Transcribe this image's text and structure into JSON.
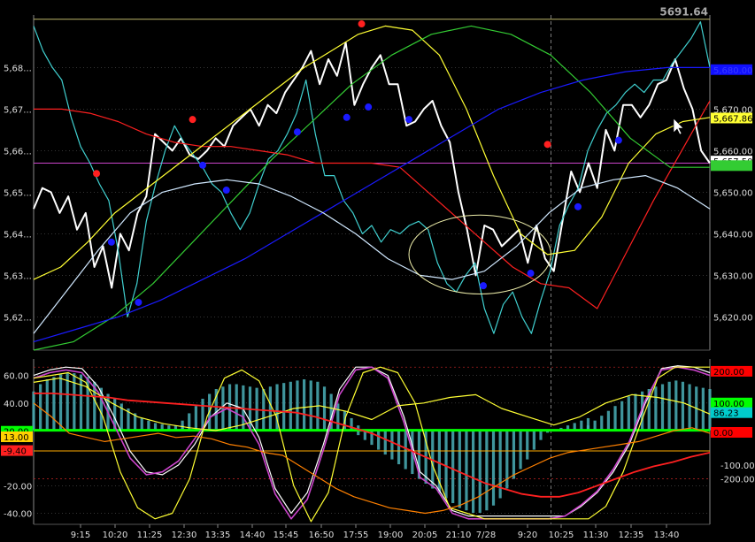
{
  "chart_data": [
    {
      "type": "line",
      "panel": "price",
      "grid": true,
      "ylim": [
        5612,
        5692
      ],
      "left_ticks": [
        "5,68...",
        "5,67...",
        "5,66...",
        "5,65...",
        "5,64...",
        "5,63...",
        "5,62..."
      ],
      "right_ticks": [
        "5,680.00",
        "5,670.00",
        "5,660.00",
        "5,650.00",
        "5,640.00",
        "5,630.00",
        "5,620.00"
      ],
      "left_tick_values": [
        5680,
        5670,
        5660,
        5650,
        5640,
        5630,
        5620
      ],
      "right_tick_values": [
        5680,
        5670,
        5660,
        5650,
        5640,
        5630,
        5620
      ],
      "top_value_label": "5691.64",
      "top_value": 5691.64,
      "value_labels": [
        {
          "text": "5,680.00",
          "value": 5679.5,
          "color": "#1010ff",
          "text_color": "#3a3aff"
        },
        {
          "text": "5,667.86",
          "value": 5667.86,
          "color": "#ffff33",
          "text_color": "#000000"
        },
        {
          "text": "5,657.50",
          "value": 5657.5,
          "color": "#ffffff",
          "text_color": "#000000"
        },
        {
          "text": "",
          "value": 5656.4,
          "color": "#33cc33",
          "text_color": "#000000"
        }
      ],
      "horizontal_lines": [
        {
          "value": 5691.64,
          "color": "#bdb76b"
        },
        {
          "value": 5657.0,
          "color": "#cc44cc"
        }
      ],
      "series": [
        {
          "color": "#ffffff",
          "width": 2,
          "values": [
            5646,
            5651,
            5650,
            5645,
            5649,
            5641,
            5645,
            5632,
            5637,
            5627,
            5640,
            5636,
            5645,
            5649,
            5664,
            5662,
            5660,
            5663,
            5659,
            5658,
            5660,
            5663,
            5661,
            5666,
            5668,
            5670,
            5666,
            5671,
            5669,
            5674,
            5677,
            5680,
            5684,
            5676,
            5682,
            5678,
            5686,
            5671,
            5676,
            5680,
            5683,
            5676,
            5676,
            5666,
            5667,
            5670,
            5672,
            5666,
            5662,
            5650,
            5641,
            5630,
            5642,
            5641,
            5637,
            5639,
            5641,
            5633,
            5642,
            5634,
            5631,
            5643,
            5655,
            5650,
            5657,
            5651,
            5665,
            5660,
            5671,
            5671,
            5668,
            5671,
            5676,
            5677,
            5682,
            5675,
            5670,
            5660,
            5657
          ]
        },
        {
          "color": "#40d0d0",
          "width": 1.2,
          "values": [
            5690,
            5684,
            5680,
            5677,
            5668,
            5661,
            5657,
            5652,
            5648,
            5636,
            5620,
            5628,
            5643,
            5652,
            5660,
            5666,
            5662,
            5659,
            5656,
            5652,
            5650,
            5645,
            5641,
            5645,
            5652,
            5658,
            5660,
            5664,
            5669,
            5677,
            5664,
            5654,
            5654,
            5648,
            5645,
            5640,
            5642,
            5638,
            5641,
            5640,
            5642,
            5643,
            5641,
            5633,
            5628,
            5626,
            5630,
            5633,
            5622,
            5616,
            5623,
            5626,
            5620,
            5616,
            5624,
            5631,
            5642,
            5647,
            5651,
            5660,
            5665,
            5669,
            5671,
            5674,
            5676,
            5674,
            5677,
            5677,
            5681,
            5684,
            5687,
            5691,
            5680
          ]
        },
        {
          "color": "#ff2020",
          "width": 1.2,
          "values": [
            5670,
            5670,
            5669,
            5667,
            5664,
            5662,
            5661,
            5661,
            5660,
            5659,
            5657,
            5657,
            5657,
            5656,
            5650,
            5644,
            5638,
            5632,
            5628,
            5627,
            5622,
            5635,
            5648,
            5660,
            5672
          ]
        },
        {
          "color": "#ffff33",
          "width": 1.2,
          "values": [
            5629,
            5632,
            5638,
            5645,
            5650,
            5655,
            5660,
            5665,
            5670,
            5675,
            5680,
            5684,
            5688,
            5690,
            5689,
            5683,
            5670,
            5654,
            5640,
            5635,
            5636,
            5644,
            5657,
            5664,
            5667,
            5668
          ]
        },
        {
          "color": "#33cc33",
          "width": 1.2,
          "values": [
            5612,
            5614,
            5620,
            5628,
            5638,
            5648,
            5658,
            5667,
            5676,
            5683,
            5688,
            5690,
            5688,
            5683,
            5674,
            5663,
            5656,
            5656
          ]
        },
        {
          "color": "#1a1aff",
          "width": 1.2,
          "values": [
            5614,
            5617,
            5620,
            5624,
            5629,
            5634,
            5640,
            5646,
            5652,
            5658,
            5664,
            5670,
            5674,
            5677,
            5679,
            5680,
            5680
          ]
        },
        {
          "color": "#d0e8ff",
          "width": 1.2,
          "values": [
            5616,
            5626,
            5636,
            5645,
            5650,
            5652,
            5653,
            5652,
            5649,
            5645,
            5640,
            5634,
            5630,
            5629,
            5631,
            5637,
            5645,
            5651,
            5653,
            5654,
            5651,
            5646
          ]
        }
      ],
      "markers": [
        {
          "x": 9.3,
          "y": 5654.5,
          "color": "#ff2020"
        },
        {
          "x": 23.5,
          "y": 5667.5,
          "color": "#ff2020"
        },
        {
          "x": 48.5,
          "y": 5690.5,
          "color": "#ff2020"
        },
        {
          "x": 76,
          "y": 5661.5,
          "color": "#ff2020"
        },
        {
          "x": 11.5,
          "y": 5638,
          "color": "#1a1aff"
        },
        {
          "x": 15.5,
          "y": 5623.5,
          "color": "#1a1aff"
        },
        {
          "x": 25,
          "y": 5656.5,
          "color": "#1a1aff"
        },
        {
          "x": 28.5,
          "y": 5650.5,
          "color": "#1a1aff"
        },
        {
          "x": 39,
          "y": 5664.5,
          "color": "#1a1aff"
        },
        {
          "x": 46.3,
          "y": 5668,
          "color": "#1a1aff"
        },
        {
          "x": 49.5,
          "y": 5670.5,
          "color": "#1a1aff"
        },
        {
          "x": 55.5,
          "y": 5667.5,
          "color": "#1a1aff"
        },
        {
          "x": 66.5,
          "y": 5627.5,
          "color": "#1a1aff"
        },
        {
          "x": 73.5,
          "y": 5630.5,
          "color": "#1a1aff"
        },
        {
          "x": 80.5,
          "y": 5646.5,
          "color": "#1a1aff"
        },
        {
          "x": 86.5,
          "y": 5662.5,
          "color": "#1a1aff"
        }
      ],
      "ellipse": {
        "cx": 66,
        "cy": 5635,
        "rx": 10.5,
        "ry": 9.5,
        "color": "#eeeeaa"
      },
      "cursor_x": 76.5
    },
    {
      "type": "line",
      "panel": "oscillator",
      "grid": true,
      "ylim": [
        -48,
        70
      ],
      "left_ticks": [
        "60.00",
        "40.00",
        "20.00",
        "-20.00",
        "-40.00"
      ],
      "left_tick_values": [
        60,
        40,
        20,
        -20,
        -40
      ],
      "right_ticks": [
        "-100.00",
        "-200.00"
      ],
      "right_tick_values": [
        -5,
        -15
      ],
      "value_labels_left": [
        {
          "text": "20.00",
          "value": 19.5,
          "color": "#00ff00",
          "text_color": "#000000"
        },
        {
          "text": "13.00",
          "value": 15.5,
          "color": "#ffd000",
          "text_color": "#000000"
        },
        {
          "text": "-9.40",
          "value": 5.5,
          "color": "#ff2020",
          "text_color": "#000000"
        }
      ],
      "value_labels_right": [
        {
          "text": "200.00",
          "value": 63,
          "color": "#ff0000",
          "text_color": "#000000"
        },
        {
          "text": "100.00",
          "value": 40,
          "color": "#00ff00",
          "text_color": "#000000"
        },
        {
          "text": "86.23",
          "value": 33,
          "color": "#00cccc",
          "text_color": "#000000"
        },
        {
          "text": "0.00",
          "value": 18.7,
          "color": "#ff0000",
          "text_color": "#000000"
        }
      ],
      "horizontal_lines": [
        {
          "value": 20.2,
          "color": "#00ff00"
        },
        {
          "value": 5.2,
          "color": "#ffaa00"
        }
      ],
      "histogram": [
        {
          "start": 0,
          "end": 22,
          "values": [
            32,
            38,
            42,
            44,
            46,
            47,
            47,
            46,
            44,
            40,
            35,
            30,
            26,
            22,
            18,
            14,
            10,
            8,
            6,
            5,
            4,
            4,
            4
          ]
        },
        {
          "start": 22,
          "end": 48,
          "values": [
            8,
            14,
            20,
            26,
            30,
            34,
            36,
            38,
            38,
            37,
            36,
            35,
            34,
            36,
            38,
            39,
            40,
            41,
            42,
            41,
            40,
            36,
            30,
            22,
            16,
            10,
            4
          ]
        },
        {
          "start": 48,
          "end": 82,
          "values": [
            -4,
            -8,
            -12,
            -16,
            -20,
            -24,
            -28,
            -32,
            -36,
            -40,
            -44,
            -48,
            -52,
            -56,
            -60,
            -64,
            -66,
            -68,
            -68,
            -66,
            -62,
            -56,
            -48,
            -40,
            -32,
            -24,
            -16,
            -8,
            -2,
            0,
            2,
            4,
            6,
            8,
            10
          ]
        },
        {
          "start": 82,
          "end": 100,
          "values": [
            4,
            8,
            12,
            16,
            20,
            24,
            28,
            30,
            32,
            34,
            36,
            38,
            40,
            41,
            40,
            38,
            36,
            35,
            34
          ]
        }
      ],
      "series": [
        {
          "color": "#ffffff",
          "width": 1.2,
          "values": [
            60,
            64,
            66,
            65,
            52,
            30,
            5,
            -10,
            -12,
            -5,
            10,
            30,
            40,
            36,
            15,
            -22,
            -40,
            -25,
            10,
            50,
            66,
            66,
            60,
            30,
            -10,
            -20,
            -38,
            -42,
            -42,
            -42,
            -42,
            -42,
            -42,
            -42,
            -35,
            -25,
            -10,
            10,
            40,
            65,
            67,
            66,
            62
          ]
        },
        {
          "color": "#cc44cc",
          "width": 1.6,
          "values": [
            58,
            62,
            64,
            62,
            48,
            24,
            0,
            -12,
            -10,
            -2,
            14,
            30,
            36,
            30,
            10,
            -26,
            -44,
            -30,
            6,
            46,
            64,
            66,
            58,
            26,
            -14,
            -22,
            -40,
            -44,
            -44,
            -44,
            -44,
            -44,
            -44,
            -42,
            -34,
            -24,
            -8,
            12,
            42,
            64,
            66,
            64,
            60
          ]
        },
        {
          "color": "#ffff33",
          "width": 1.2,
          "values": [
            58,
            60,
            62,
            55,
            30,
            -10,
            -36,
            -44,
            -40,
            -15,
            30,
            58,
            64,
            56,
            30,
            -20,
            -46,
            -25,
            30,
            62,
            66,
            62,
            40,
            -5,
            -36,
            -40,
            -44,
            -44,
            -44,
            -44,
            -44,
            -44,
            -44,
            -35,
            -10,
            25,
            58,
            66,
            66,
            66
          ]
        },
        {
          "color": "#ffff33",
          "width": 1.2,
          "values": [
            55,
            58,
            52,
            40,
            30,
            25,
            22,
            20,
            24,
            30,
            36,
            38,
            34,
            28,
            38,
            40,
            44,
            46,
            36,
            30,
            24,
            30,
            40,
            46,
            44,
            40,
            32
          ]
        },
        {
          "color": "#ff2020",
          "width": 1.8,
          "values": [
            47,
            47,
            46,
            45,
            44,
            42,
            41,
            40,
            39,
            38,
            37,
            36,
            35,
            34,
            33,
            30,
            26,
            22,
            18,
            12,
            6,
            0,
            -6,
            -12,
            -18,
            -22,
            -26,
            -28,
            -28,
            -25,
            -20,
            -15,
            -10,
            -6,
            -3,
            1,
            4
          ]
        },
        {
          "color": "#ff8000",
          "width": 1.2,
          "values": [
            40,
            30,
            18,
            15,
            12,
            14,
            16,
            18,
            15,
            16,
            14,
            10,
            8,
            4,
            2,
            -6,
            -14,
            -22,
            -28,
            -32,
            -36,
            -38,
            -40,
            -38,
            -34,
            -28,
            -20,
            -12,
            -6,
            0,
            4,
            6,
            8,
            10,
            12,
            16,
            20,
            22,
            18
          ]
        }
      ]
    }
  ],
  "x_axis_labels": [
    "9:15",
    "10:20",
    "11:25",
    "12:30",
    "13:35",
    "14:40",
    "15:45",
    "16:50",
    "17:55",
    "19:00",
    "20:05",
    "21:10",
    "7/28",
    "9:20",
    "10:25",
    "11:30",
    "12:35",
    "13:40"
  ]
}
